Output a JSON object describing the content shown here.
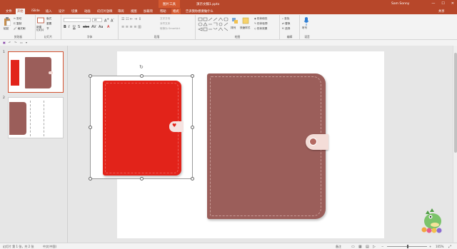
{
  "titlebar": {
    "context_tab": "图片工具",
    "document": "演示文稿1.pptx",
    "user": "Sam Sonny",
    "min": "—",
    "max": "☐",
    "close": "✕"
  },
  "tabs": [
    {
      "label": "文件"
    },
    {
      "label": "开始"
    },
    {
      "label": "iSlide"
    },
    {
      "label": "插入"
    },
    {
      "label": "设计"
    },
    {
      "label": "切换"
    },
    {
      "label": "动画"
    },
    {
      "label": "幻灯片放映"
    },
    {
      "label": "审阅"
    },
    {
      "label": "视图"
    },
    {
      "label": "加载项"
    },
    {
      "label": "帮助"
    },
    {
      "label": "格式"
    }
  ],
  "tell_me": "告诉我你想要做什么",
  "share": "共享",
  "ribbon": {
    "clipboard": {
      "paste": "粘贴",
      "cut": "剪切",
      "copy": "复制",
      "format_painter": "格式刷",
      "label": "剪贴板"
    },
    "slides": {
      "new_slide": "新建\n幻灯片",
      "layout": "版式",
      "reset": "重置",
      "section": "节",
      "label": "幻灯片"
    },
    "font": {
      "font_size": "18",
      "label": "字体"
    },
    "paragraph": {
      "text_direction": "文字方向",
      "align_text": "对齐文本",
      "smartart": "转换为 SmartArt",
      "label": "段落"
    },
    "drawing": {
      "arrange": "排列",
      "quick_styles": "快速样式",
      "shape_fill": "形状填充",
      "shape_outline": "形状轮廓",
      "shape_effects": "形状效果",
      "label": "绘图"
    },
    "editing": {
      "find": "查找",
      "replace": "替换",
      "select": "选择",
      "label": "编辑"
    },
    "voice": {
      "dictate": "听写",
      "label": "语音"
    }
  },
  "slides_panel": [
    {
      "number": "1"
    },
    {
      "number": "2"
    }
  ],
  "status": {
    "slide_info": "幻灯片 第 1 张，共 2 张",
    "language": "中文(中国)",
    "notes": "备注",
    "zoom": "105%"
  },
  "colors": {
    "accent": "#b7472a",
    "red_notebook": "#e2231a",
    "brown_notebook": "#9b5e5a"
  }
}
